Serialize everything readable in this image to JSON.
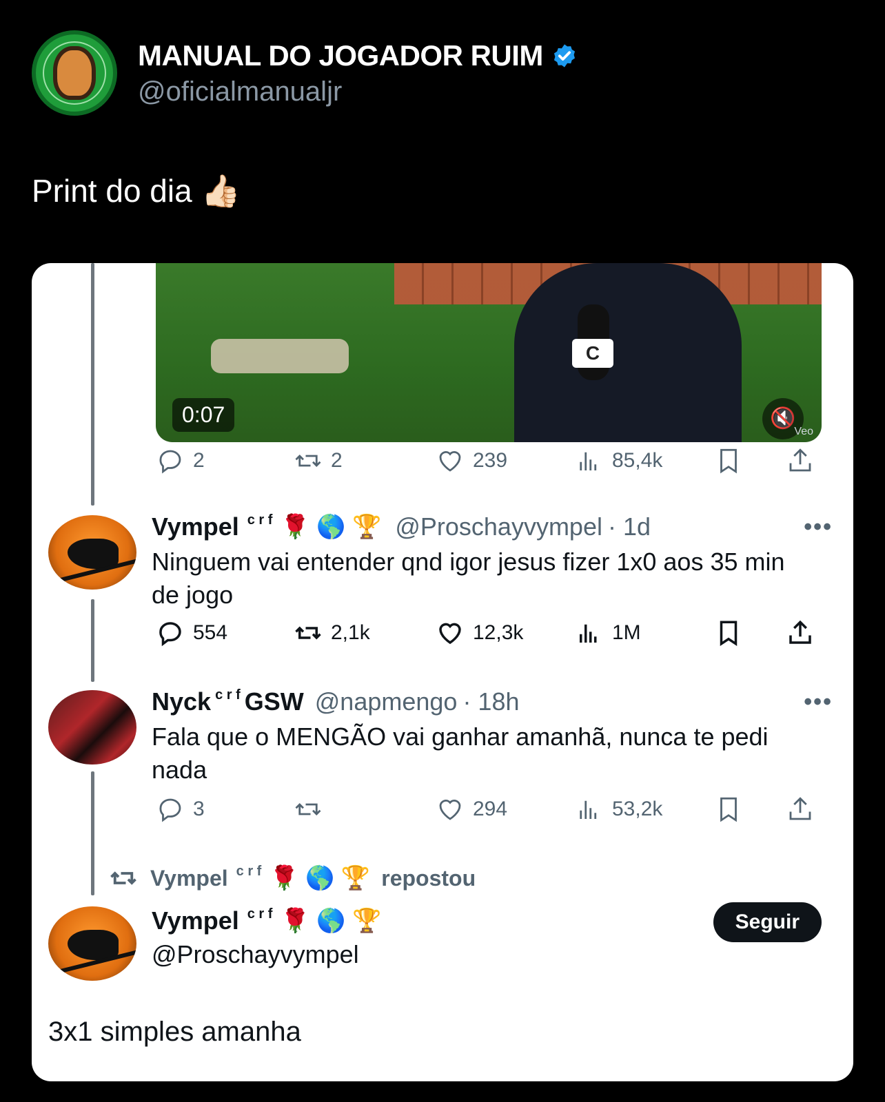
{
  "main_tweet": {
    "display_name": "MANUAL DO JOGADOR RUIM",
    "handle": "@oficialmanualjr",
    "text": "Print do dia 👍🏻"
  },
  "screenshot": {
    "video": {
      "timer": "0:07",
      "mute_icon": "speaker-mute-icon",
      "watermark": "Veo",
      "mic_logo": "C"
    },
    "video_actions": {
      "replies": "2",
      "reposts": "2",
      "likes": "239",
      "views": "85,4k"
    },
    "post1": {
      "name": "Vympel",
      "sup": "c r f",
      "emojis": "🌹 🌎 🏆",
      "handle": "@Proschayvympel",
      "time": "· 1d",
      "more": "•••",
      "text": "Ninguem vai entender qnd igor jesus fizer 1x0 aos 35 min de jogo",
      "replies": "554",
      "reposts": "2,1k",
      "likes": "12,3k",
      "views": "1M"
    },
    "post2": {
      "name_prefix": "Nyck",
      "sup": "c r f",
      "name_suffix": "GSW",
      "handle": "@napmengo",
      "time": "· 18h",
      "more": "•••",
      "text": "Fala que o MENGÃO vai ganhar amanhã, nunca te pedi nada",
      "replies": "3",
      "reposts": "",
      "likes": "294",
      "views": "53,2k"
    },
    "repost": {
      "name": "Vympel",
      "sup": "c r f",
      "emojis": "🌹 🌎 🏆",
      "label": "repostou"
    },
    "profile": {
      "name": "Vympel",
      "sup": "c r f",
      "emojis": "🌹 🌎 🏆",
      "handle": "@Proschayvympel",
      "follow_label": "Seguir",
      "text": "3x1 simples amanha"
    }
  },
  "colors": {
    "background": "#000000",
    "card": "#ffffff",
    "verified": "#1d9bf0",
    "muted": "#536471"
  }
}
